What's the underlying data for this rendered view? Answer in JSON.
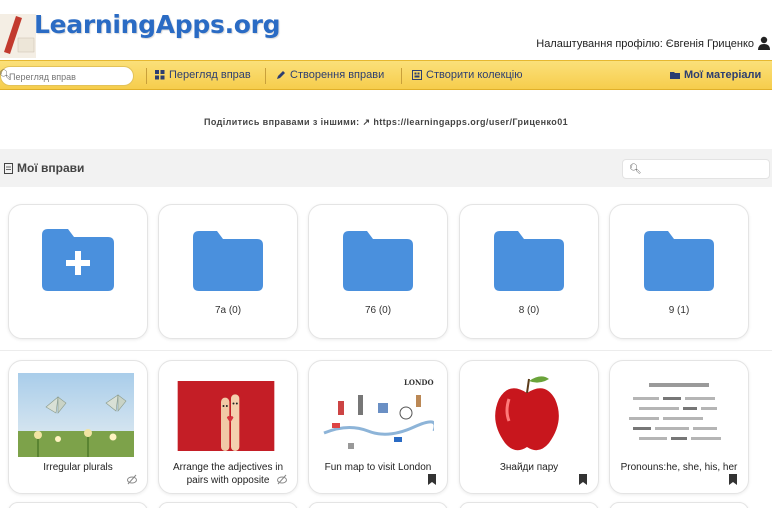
{
  "header": {
    "logo_text": "LearningApps.org",
    "profile_link": "Налаштування профілю: Євгенія Гриценко"
  },
  "navbar": {
    "search_placeholder": "Перегляд вправ",
    "items": [
      {
        "label": "Перегляд вправ",
        "icon": "grid-icon"
      },
      {
        "label": "Створення вправи",
        "icon": "pencil-icon"
      },
      {
        "label": "Створити колекцію",
        "icon": "collection-icon"
      },
      {
        "label": "Мої матеріали",
        "icon": "folder-icon"
      }
    ]
  },
  "share": {
    "text": "Поділитись вправами з іншими: ",
    "url": "https://learningapps.org/user/Гриценко01"
  },
  "my_exercises": {
    "title": "Мої вправи",
    "search_icon": "search-icon"
  },
  "folders": [
    {
      "label": "",
      "type": "new-folder"
    },
    {
      "label": "7a (0)"
    },
    {
      "label": "76 (0)"
    },
    {
      "label": "8 (0)"
    },
    {
      "label": "9 (1)"
    }
  ],
  "apps": [
    {
      "title": "Irregular plurals",
      "badge": "shared-icon"
    },
    {
      "title": "Arrange the adjectives in pairs with opposite",
      "badge": "shared-icon"
    },
    {
      "title": "Fun map to visit London",
      "badge": "bookmark-icon",
      "thumb_text": "LONDON"
    },
    {
      "title": "Знайди пару",
      "badge": "bookmark-icon"
    },
    {
      "title": "Pronouns:he, she, his, her",
      "badge": "bookmark-icon"
    }
  ],
  "colors": {
    "brand_blue": "#2a6bc4",
    "folder_blue": "#4a90dd",
    "nav_yellow": "#f6cd4c",
    "nav_text": "#2d3e70"
  }
}
